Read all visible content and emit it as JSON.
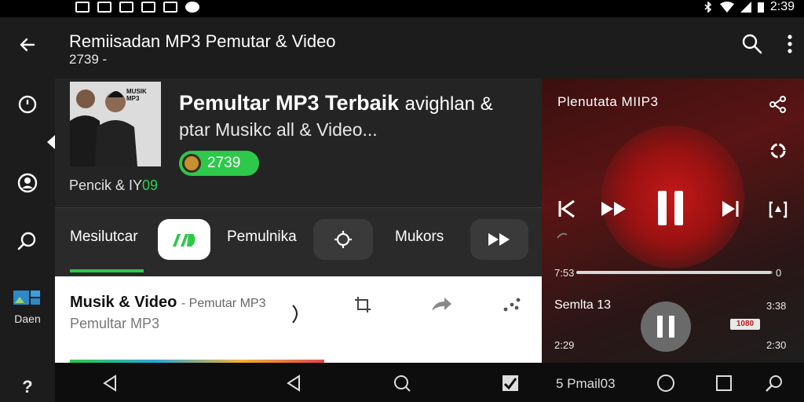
{
  "status": {
    "time": "2:39"
  },
  "app_bar": {
    "title": "Remiisadan MP3 Pemutar & Video",
    "subtitle": "2739 -"
  },
  "rail": {
    "bottom_label": "Daen",
    "help_glyph": "?"
  },
  "header": {
    "track_title": "Pemultar MP3 Terbaik",
    "track_title_tail": "avighlan &",
    "track_desc": "ptar Musikc all & Video...",
    "count": "2739",
    "caption_prefix": "Pencik & IY",
    "caption_highlight": "09",
    "cover_text": "MUSIK MP3"
  },
  "tabs": [
    {
      "label": "Mesilutcar"
    },
    {
      "label": "Pemulnika"
    },
    {
      "label": "Mukors"
    }
  ],
  "list": {
    "title": "Musik & Video",
    "title_suffix": "- Pemutar MP3",
    "subtitle": "Pemultar MP3"
  },
  "player": {
    "title": "Plenutata MIIP3",
    "time_start": "7:53",
    "time_end": "0",
    "progress": 0.99,
    "queue": [
      {
        "label": "Semlta 13",
        "time": "3:38"
      },
      {
        "label": "2:29",
        "time": "2:30"
      }
    ],
    "badge": "1080"
  },
  "nav": {
    "label": "5 Pmail03"
  },
  "colors": {
    "accent": "#2ec84a",
    "player_red": "#c41818"
  }
}
